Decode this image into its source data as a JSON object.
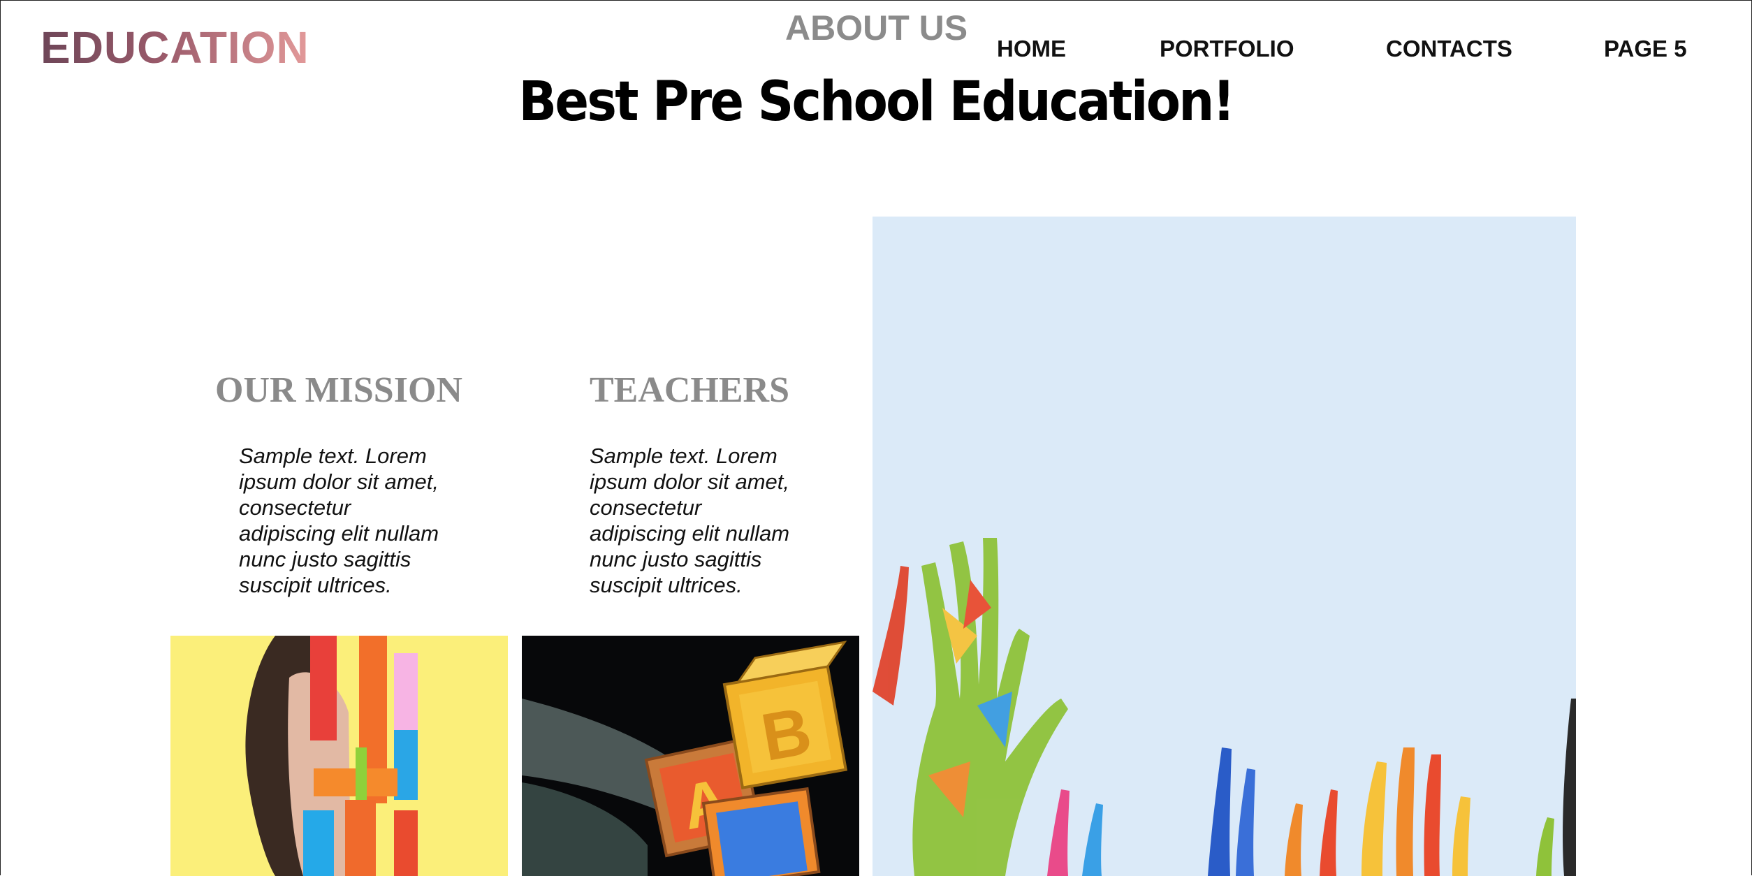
{
  "brand": {
    "logo_text": "EDUCATION"
  },
  "header": {
    "about_label": "ABOUT US",
    "nav": [
      "HOME",
      "PORTFOLIO",
      "CONTACTS",
      "PAGE 5"
    ]
  },
  "hero": {
    "title": "Best Pre School Education!"
  },
  "columns": [
    {
      "title": "OUR MISSION",
      "text": "Sample text. Lorem ipsum dolor sit amet, consectetur adipiscing elit nullam nunc justo sagittis suscipit ultrices.",
      "image": "child-with-colorful-blocks"
    },
    {
      "title": "TEACHERS",
      "text": "Sample text. Lorem ipsum dolor sit amet, consectetur adipiscing elit nullam nunc justo sagittis suscipit ultrices.",
      "image": "abc-toy-blocks"
    }
  ],
  "feature_image": "painted-hands-raised-against-sky",
  "colors": {
    "logo_start": "#6e4658",
    "logo_end": "#e39a9a",
    "heading_gray": "#8a8a8a"
  }
}
